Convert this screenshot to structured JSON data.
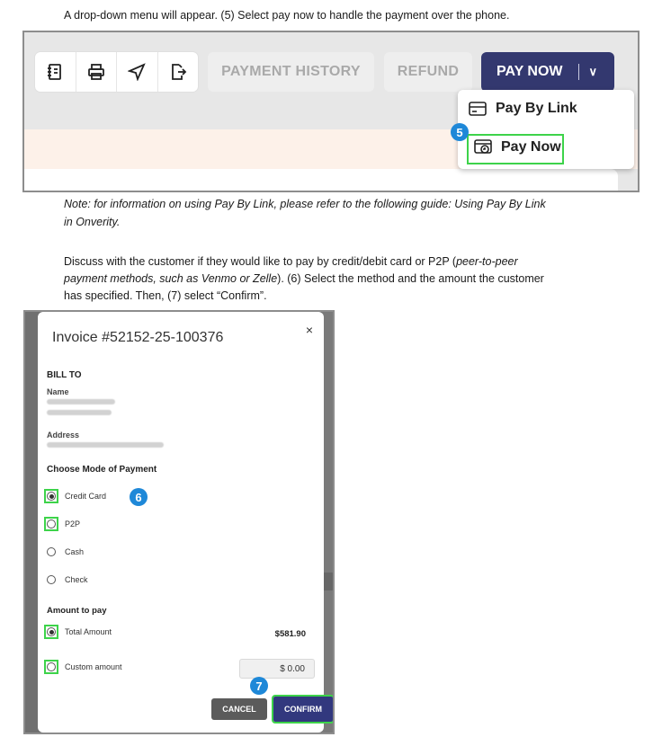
{
  "doc": {
    "intro": "A drop-down menu will appear. (5) Select pay now to handle the payment over the phone.",
    "note_line1": "Note: for information on using Pay By Link, please refer to the following guide: Using Pay By Link",
    "note_line2": "in Onverity.",
    "discuss_line1": "Discuss with the customer if they would like to pay by credit/debit card or P2P (",
    "discuss_line1_italic": "peer-to-peer",
    "discuss_line2_italic": "payment methods, such as Venmo or Zelle",
    "discuss_line2": "). (6) Select the method and the amount the customer",
    "discuss_line3": "has specified. Then, (7) select “Confirm”."
  },
  "toolbar": {
    "icons": [
      "invoice-icon",
      "print-icon",
      "send-icon",
      "export-icon"
    ],
    "payment_history": "PAYMENT HISTORY",
    "refund": "REFUND",
    "pay_now": "PAY NOW",
    "chevron": "∨"
  },
  "dropdown": {
    "pay_by_link": "Pay By Link",
    "pay_now": "Pay Now"
  },
  "steps": {
    "s5": "5",
    "s6": "6",
    "s7": "7"
  },
  "modal": {
    "title": "Invoice #52152-25-100376",
    "close": "×",
    "bill_to": "BILL TO",
    "name_label": "Name",
    "address_label": "Address",
    "choose_mode": "Choose Mode of Payment",
    "payment_modes": [
      "Credit Card",
      "P2P",
      "Cash",
      "Check"
    ],
    "selected_mode": "Credit Card",
    "amount_to_pay": "Amount to pay",
    "total_amount_label": "Total Amount",
    "total_amount_value": "$581.90",
    "custom_amount_label": "Custom amount",
    "custom_amount_value": "$ 0.00",
    "cancel": "CANCEL",
    "confirm": "CONFIRM"
  },
  "colors": {
    "primary": "#33386f",
    "highlight": "#3dd34a",
    "step_badge": "#1e88d8"
  }
}
